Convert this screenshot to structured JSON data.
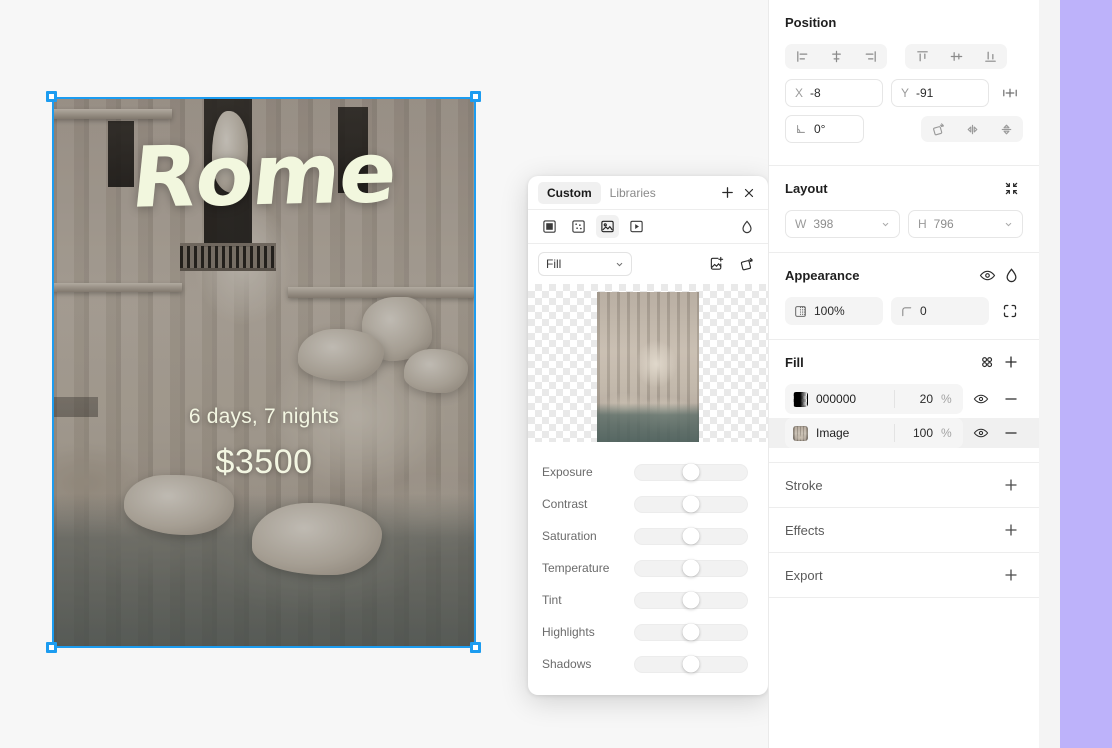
{
  "canvas": {
    "artboard": {
      "title": "Rome",
      "subtitle": "6 days, 7 nights",
      "price": "$3500"
    },
    "selection": {
      "accent_color": "#1c9cf0",
      "handle_fill": "#ffffff"
    },
    "background_color": "#f7f7f7"
  },
  "float_panel": {
    "tabs": [
      {
        "label": "Custom",
        "active": true
      },
      {
        "label": "Libraries",
        "active": false
      }
    ],
    "header_actions": [
      {
        "name": "add-icon",
        "glyph": "+"
      },
      {
        "name": "close-icon",
        "glyph": "x"
      }
    ],
    "fill_types": [
      {
        "name": "solid-fill-icon",
        "selected": false
      },
      {
        "name": "pattern-fill-icon",
        "selected": false
      },
      {
        "name": "image-fill-icon",
        "selected": true
      },
      {
        "name": "video-fill-icon",
        "selected": false
      }
    ],
    "blend_icon": "droplet-icon",
    "scale_mode": "Fill",
    "row_actions": [
      {
        "name": "replace-image-icon"
      },
      {
        "name": "rotate-image-icon"
      }
    ],
    "adjustments": [
      {
        "label": "Exposure",
        "value": 50
      },
      {
        "label": "Contrast",
        "value": 50
      },
      {
        "label": "Saturation",
        "value": 50
      },
      {
        "label": "Temperature",
        "value": 50
      },
      {
        "label": "Tint",
        "value": 50
      },
      {
        "label": "Highlights",
        "value": 50
      },
      {
        "label": "Shadows",
        "value": 50
      }
    ]
  },
  "right_panel": {
    "position": {
      "title": "Position",
      "align_horizontal": [
        {
          "name": "align-left-icon"
        },
        {
          "name": "align-center-horizontal-icon"
        },
        {
          "name": "align-right-icon"
        }
      ],
      "align_vertical": [
        {
          "name": "align-top-icon"
        },
        {
          "name": "align-middle-vertical-icon"
        },
        {
          "name": "align-bottom-icon"
        }
      ],
      "x_key": "X",
      "x_value": "-8",
      "y_key": "Y",
      "y_value": "-91",
      "add_position_icon": "add-position-icon",
      "rotation_value": "0°",
      "transform_buttons": [
        {
          "name": "rotate-icon"
        },
        {
          "name": "flip-horizontal-icon"
        },
        {
          "name": "flip-vertical-icon"
        }
      ]
    },
    "layout": {
      "title": "Layout",
      "fit_icon": "resize-to-fit-icon",
      "w_key": "W",
      "w_value": "398",
      "h_key": "H",
      "h_value": "796"
    },
    "appearance": {
      "title": "Appearance",
      "visibility_icon": "eye-icon",
      "blend_icon": "droplet-icon",
      "opacity_value": "100%",
      "corner_radius_value": "0",
      "independent_corners_icon": "independent-corners-icon"
    },
    "fill": {
      "title": "Fill",
      "styles_icon": "fill-styles-icon",
      "add_icon": "add-fill-icon",
      "rows": [
        {
          "swatch": "black-alpha",
          "name": "000000",
          "opacity": "20",
          "unit": "%",
          "visible_icon": "eye-icon",
          "remove_icon": "remove-icon",
          "highlighted": false
        },
        {
          "swatch": "image",
          "name": "Image",
          "opacity": "100",
          "unit": "%",
          "visible_icon": "eye-icon",
          "remove_icon": "remove-icon",
          "highlighted": true
        }
      ]
    },
    "collapsed_sections": [
      {
        "title": "Stroke",
        "add_icon": "add-stroke-icon"
      },
      {
        "title": "Effects",
        "add_icon": "add-effect-icon"
      },
      {
        "title": "Export",
        "add_icon": "add-export-icon"
      }
    ]
  },
  "decor": {
    "purple_strip_color": "#bdb2fa",
    "panel_gap_color": "#f4f4f4"
  }
}
